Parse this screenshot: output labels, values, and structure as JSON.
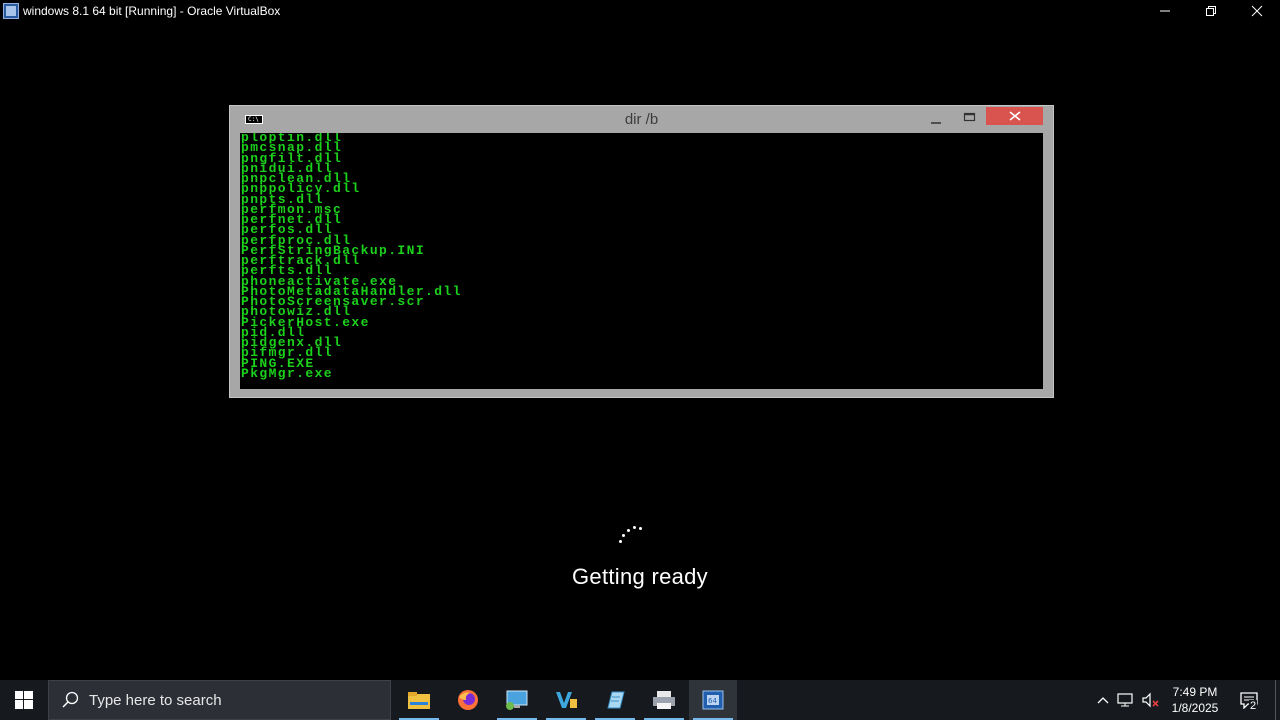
{
  "host": {
    "title": "windows 8.1 64 bit [Running] - Oracle VirtualBox",
    "icon": "virtualbox-icon"
  },
  "cmd": {
    "title": "dir /b",
    "icon_text": "C:\\",
    "lines": [
      "ploptin.dll",
      "pmcsnap.dll",
      "pngfilt.dll",
      "pnidui.dll",
      "pnpclean.dll",
      "pnppolicy.dll",
      "pnpts.dll",
      "perfmon.msc",
      "perfnet.dll",
      "perfos.dll",
      "perfproc.dll",
      "PerfStringBackup.INI",
      "perftrack.dll",
      "perfts.dll",
      "phoneactivate.exe",
      "PhotoMetadataHandler.dll",
      "PhotoScreensaver.scr",
      "photowiz.dll",
      "PickerHost.exe",
      "pid.dll",
      "pidgenx.dll",
      "pifmgr.dll",
      "PING.EXE",
      "PkgMgr.exe"
    ]
  },
  "status": {
    "message": "Getting ready"
  },
  "taskbar": {
    "search_placeholder": "Type here to search",
    "apps": [
      "file-explorer",
      "firefox",
      "remote-desktop",
      "visual-studio",
      "notepad",
      "printer-manager",
      "virtualbox"
    ],
    "clock_time": "7:49 PM",
    "clock_date": "1/8/2025",
    "notification_count": "2"
  },
  "colors": {
    "console_text": "#1cd11c",
    "close_button": "#d9534f",
    "taskbar": "#16191e"
  }
}
